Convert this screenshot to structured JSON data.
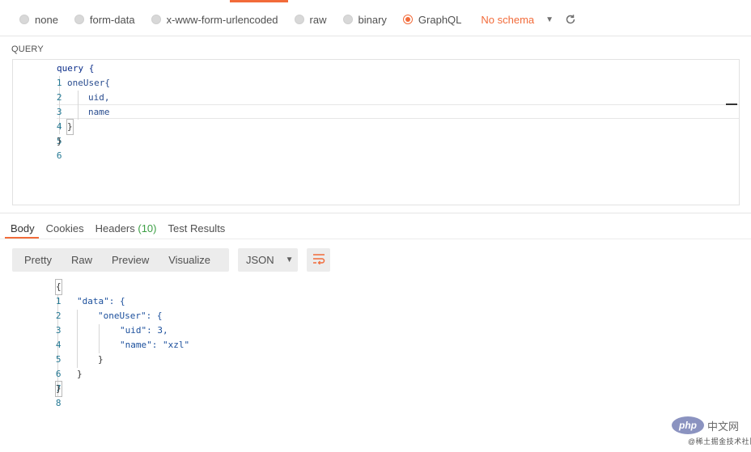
{
  "body_types": {
    "options": [
      {
        "label": "none",
        "selected": false
      },
      {
        "label": "form-data",
        "selected": false
      },
      {
        "label": "x-www-form-urlencoded",
        "selected": false
      },
      {
        "label": "raw",
        "selected": false
      },
      {
        "label": "binary",
        "selected": false
      },
      {
        "label": "GraphQL",
        "selected": true
      }
    ],
    "schema_label": "No schema",
    "dropdown_icon": "caret-down-icon",
    "refresh_icon": "refresh-icon"
  },
  "query": {
    "section_label": "QUERY",
    "lines": [
      {
        "n": "1",
        "text": "query {"
      },
      {
        "n": "2",
        "text": "oneUser{"
      },
      {
        "n": "3",
        "text": "uid,"
      },
      {
        "n": "4",
        "text": "name"
      },
      {
        "n": "5",
        "text": "}"
      },
      {
        "n": "6",
        "text": "}"
      }
    ]
  },
  "response_tabs": {
    "body": "Body",
    "cookies": "Cookies",
    "headers": "Headers",
    "headers_count": "(10)",
    "test_results": "Test Results",
    "active": "Body"
  },
  "view_controls": {
    "pretty": "Pretty",
    "raw": "Raw",
    "preview": "Preview",
    "visualize": "Visualize",
    "format": "JSON",
    "wrap_icon": "wrap-lines-icon"
  },
  "response": {
    "lines": [
      {
        "n": "1",
        "text": "{"
      },
      {
        "n": "2",
        "text": "\"data\": {"
      },
      {
        "n": "3",
        "text": "\"oneUser\": {"
      },
      {
        "n": "4",
        "text": "\"uid\": 3,"
      },
      {
        "n": "5",
        "text": "\"name\": \"xzl\""
      },
      {
        "n": "6",
        "text": "}"
      },
      {
        "n": "7",
        "text": "}"
      },
      {
        "n": "8",
        "text": "}"
      }
    ]
  },
  "watermark": {
    "badge": "php",
    "name": "中文网",
    "sub": "@稀土掘金技术社区"
  },
  "colors": {
    "accent": "#f26b3a",
    "count_green": "#3b9e43",
    "keyword_blue": "#0b2d8a",
    "line_number": "#237893"
  }
}
